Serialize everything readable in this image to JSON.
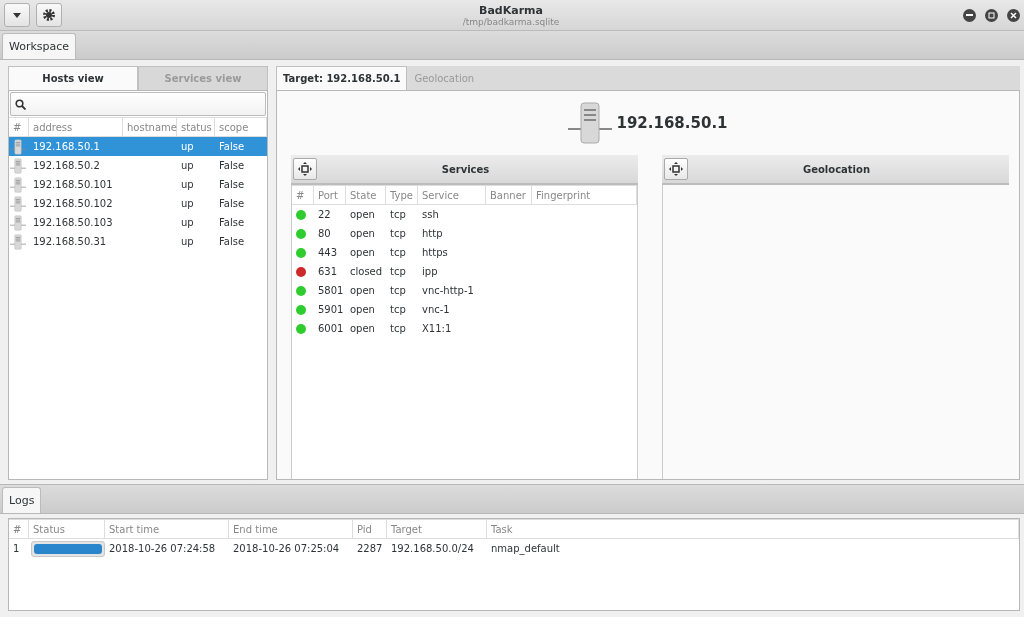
{
  "window": {
    "title": "BadKarma",
    "subtitle": "/tmp/badkarma.sqlite"
  },
  "main_tabs": [
    {
      "label": "Workspace",
      "selected": true
    }
  ],
  "left_tabs": [
    {
      "label": "Hosts view",
      "selected": true
    },
    {
      "label": "Services view",
      "selected": false
    }
  ],
  "hosts_table": {
    "columns": [
      "#",
      "address",
      "hostname",
      "status",
      "scope"
    ],
    "rows": [
      {
        "address": "192.168.50.1",
        "hostname": "",
        "status": "up",
        "scope": "False",
        "selected": true
      },
      {
        "address": "192.168.50.2",
        "hostname": "",
        "status": "up",
        "scope": "False",
        "selected": false
      },
      {
        "address": "192.168.50.101",
        "hostname": "",
        "status": "up",
        "scope": "False",
        "selected": false
      },
      {
        "address": "192.168.50.102",
        "hostname": "",
        "status": "up",
        "scope": "False",
        "selected": false
      },
      {
        "address": "192.168.50.103",
        "hostname": "",
        "status": "up",
        "scope": "False",
        "selected": false
      },
      {
        "address": "192.168.50.31",
        "hostname": "",
        "status": "up",
        "scope": "False",
        "selected": false
      }
    ]
  },
  "right_tabs": [
    {
      "label": "Target: 192.168.50.1",
      "selected": true
    },
    {
      "label": "Geolocation",
      "selected": false
    }
  ],
  "target": {
    "address": "192.168.50.1"
  },
  "services_panel": {
    "title": "Services",
    "columns": [
      "#",
      "Port",
      "State",
      "Type",
      "Service",
      "Banner",
      "Fingerprint"
    ],
    "rows": [
      {
        "color": "#2ecc2e",
        "port": "22",
        "state": "open",
        "type": "tcp",
        "service": "ssh"
      },
      {
        "color": "#2ecc2e",
        "port": "80",
        "state": "open",
        "type": "tcp",
        "service": "http"
      },
      {
        "color": "#2ecc2e",
        "port": "443",
        "state": "open",
        "type": "tcp",
        "service": "https"
      },
      {
        "color": "#cc2a2a",
        "port": "631",
        "state": "closed",
        "type": "tcp",
        "service": "ipp"
      },
      {
        "color": "#2ecc2e",
        "port": "5801",
        "state": "open",
        "type": "tcp",
        "service": "vnc-http-1"
      },
      {
        "color": "#2ecc2e",
        "port": "5901",
        "state": "open",
        "type": "tcp",
        "service": "vnc-1"
      },
      {
        "color": "#2ecc2e",
        "port": "6001",
        "state": "open",
        "type": "tcp",
        "service": "X11:1"
      }
    ]
  },
  "geolocation_panel": {
    "title": "Geolocation"
  },
  "logs_tabs": [
    {
      "label": "Logs",
      "selected": true
    }
  ],
  "logs_table": {
    "columns": [
      "#",
      "Status",
      "Start time",
      "End time",
      "Pid",
      "Target",
      "Task"
    ],
    "rows": [
      {
        "index": "1",
        "level": 1,
        "start": "2018-10-26 07:24:58",
        "end": "2018-10-26 07:25:04",
        "pid": "2287",
        "target": "192.168.50.0/24",
        "task": "nmap_default"
      }
    ]
  }
}
